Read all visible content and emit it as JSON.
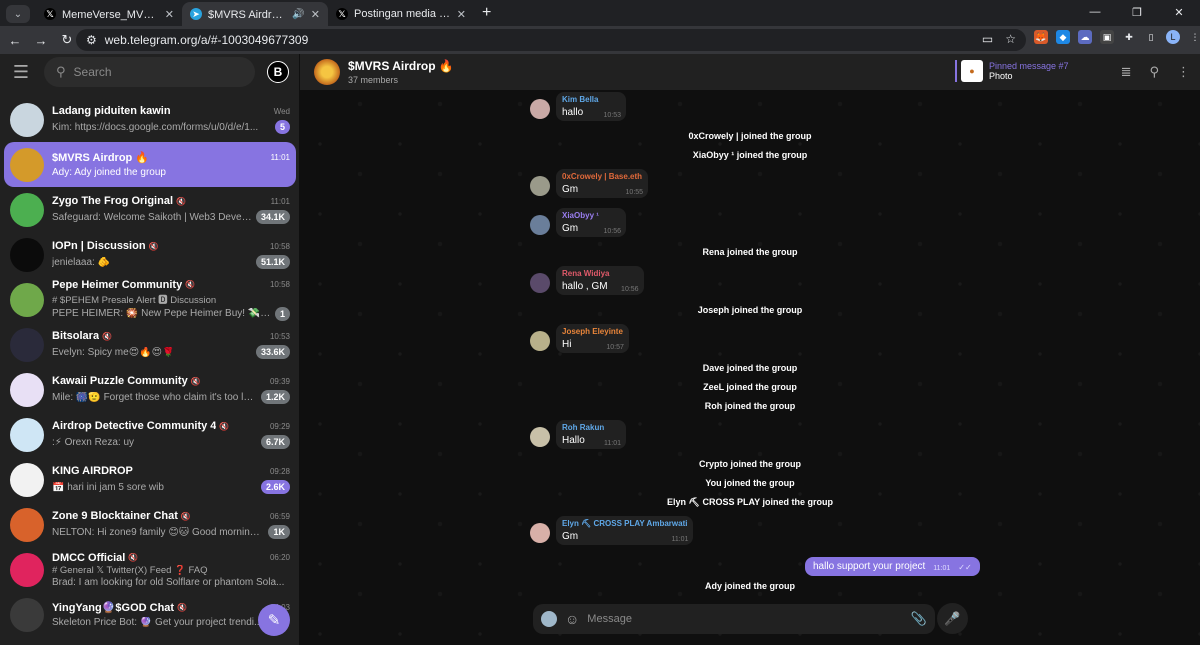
{
  "browser": {
    "tabs": [
      {
        "title": "MemeVerse_MVRS di X: \"🤩 Ha...",
        "favicon": "x-logo-icon"
      },
      {
        "title": "$MVRS Airdrop 🔥",
        "favicon": "telegram-icon"
      },
      {
        "title": "Postingan media oleh Cici (@ci...",
        "favicon": "x-logo-icon"
      }
    ],
    "url": "web.telegram.org/a/#-1003049677309",
    "profile_initial": "L"
  },
  "sidebar": {
    "search_placeholder": "Search",
    "chats": [
      {
        "name": "Ladang piduiten kawin",
        "time": "Wed",
        "last": "Kim: https://docs.google.com/forms/u/0/d/e/1...",
        "badge": "5",
        "avatar_color": "#c9d6df",
        "muted": false
      },
      {
        "name": "$MVRS Airdrop 🔥",
        "time": "11:01",
        "last": "Ady: Ady joined the group",
        "badge": "",
        "avatar_color": "#d49a2a",
        "muted": false
      },
      {
        "name": "Zygo The Frog Original",
        "time": "11:01",
        "last": "Safeguard: Welcome Saikoth | Web3 Develop...",
        "badge": "34.1K",
        "avatar_color": "#4caf50",
        "muted": true
      },
      {
        "name": "IOPn | Discussion",
        "time": "10:58",
        "last": "jenielaaa: 🫵",
        "badge": "51.1K",
        "avatar_color": "#0b0b0b",
        "muted": true
      },
      {
        "name": "Pepe Heimer Community",
        "time": "10:58",
        "last": "PEPE HEIMER: 🎇 New Pepe Heimer Buy! 💸😊...",
        "sub": "# $PEHEM Presale Alert 🅳 Discussion",
        "badge": "1",
        "avatar_color": "#6fa84a",
        "muted": true
      },
      {
        "name": "Bitsolara",
        "time": "10:53",
        "last": "Evelyn: Spicy me😍🔥😍🌹",
        "badge": "33.6K",
        "avatar_color": "#2a2a3a",
        "muted": true
      },
      {
        "name": "Kawaii Puzzle Community",
        "time": "09:39",
        "last": "Mile: 🎆🫡 Forget those who claim it's too lat...",
        "badge": "1.2K",
        "avatar_color": "#e8e0f5",
        "muted": true
      },
      {
        "name": "Airdrop Detective Community 4",
        "time": "09:29",
        "last": ":⚡ Orexn Reza: uy",
        "badge": "6.7K",
        "avatar_color": "#cfe6f5",
        "muted": true
      },
      {
        "name": "KING AIRDROP",
        "time": "09:28",
        "last": "📅 hari ini jam 5 sore wib",
        "badge": "2.6K",
        "avatar_color": "#f2f2f2",
        "muted": false
      },
      {
        "name": "Zone 9 Blocktainer Chat",
        "time": "06:59",
        "last": "NELTON: Hi zone9 family 😊🐱 Good morning a...",
        "badge": "1K",
        "avatar_color": "#d8622b",
        "muted": true
      },
      {
        "name": "DMCC Official",
        "time": "06:20",
        "last": "Brad: I am looking for old Solflare or phantom Sola...",
        "sub": "# General 𝕏 Twitter(X) Feed ❓ FAQ",
        "badge": "",
        "avatar_color": "#e0245e",
        "muted": true
      },
      {
        "name": "YingYang🔮$GOD Chat",
        "time": "04:03",
        "last": "Skeleton Price Bot: 🔮 Get your project trendi...",
        "badge": "",
        "avatar_color": "#3a3a3a",
        "muted": true
      }
    ]
  },
  "chat": {
    "title": "$MVRS Airdrop 🔥",
    "members": "37 members",
    "pinned_title": "Pinned message #7",
    "pinned_desc": "Photo",
    "composer_placeholder": "Message",
    "messages": [
      {
        "kind": "msg",
        "name": "Kim Bella",
        "text": "hallo",
        "time": "10:53",
        "name_color": "#5fa8e8",
        "av": "#c9a9a6"
      },
      {
        "kind": "svc",
        "text": "0xCrowely | joined the group"
      },
      {
        "kind": "svc",
        "text": "XiaObyy ¹ joined the group"
      },
      {
        "kind": "msg",
        "name": "0xCrowely | Base.eth",
        "text": "Gm",
        "time": "10:55",
        "name_color": "#e0693a",
        "av": "#9a9a8a"
      },
      {
        "kind": "msg",
        "name": "XiaObyy ¹",
        "text": "Gm",
        "time": "10:56",
        "name_color": "#9a7ef0",
        "av": "#6a7e9a"
      },
      {
        "kind": "svc",
        "text": "Rena joined the group"
      },
      {
        "kind": "msg",
        "name": "Rena Widiya",
        "text": "hallo , GM",
        "time": "10:56",
        "name_color": "#e05a6a",
        "av": "#5a4a6a"
      },
      {
        "kind": "svc",
        "text": "Joseph joined the group"
      },
      {
        "kind": "msg",
        "name": "Joseph Eleyinte",
        "text": "Hi",
        "time": "10:57",
        "name_color": "#e9853a",
        "av": "#b8b08a"
      },
      {
        "kind": "svc",
        "text": "Dave joined the group"
      },
      {
        "kind": "svc",
        "text": "ZeeL joined the group"
      },
      {
        "kind": "svc",
        "text": "Roh joined the group"
      },
      {
        "kind": "msg",
        "name": "Roh Rakun",
        "text": "Hallo",
        "time": "11:01",
        "name_color": "#5fa8e8",
        "av": "#c8c0a8"
      },
      {
        "kind": "svc",
        "text": "Crypto joined the group"
      },
      {
        "kind": "svc",
        "text": "You joined the group"
      },
      {
        "kind": "svc",
        "text": "Elyn ⛏ CROSS PLAY joined the group"
      },
      {
        "kind": "msg",
        "name": "Elyn ⛏ CROSS PLAY Ambarwati",
        "text": "Gm",
        "time": "11:01",
        "name_color": "#5fa8e8",
        "av": "#d8b0a8"
      },
      {
        "kind": "out",
        "text": "hallo support your project",
        "time": "11:01"
      },
      {
        "kind": "svc",
        "text": "Ady joined the group"
      }
    ]
  }
}
